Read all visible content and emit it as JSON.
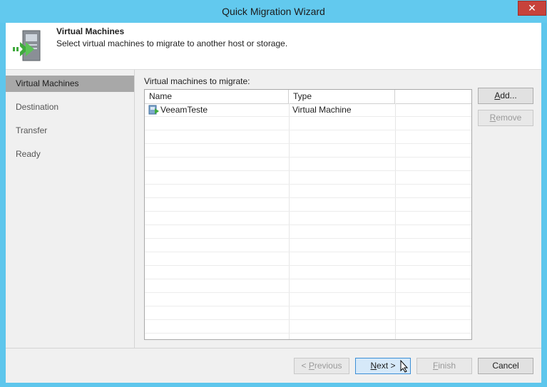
{
  "window": {
    "title": "Quick Migration Wizard",
    "close_glyph": "✕"
  },
  "header": {
    "title": "Virtual Machines",
    "subtitle": "Select virtual machines to migrate to another host or storage.",
    "icon": "vm-migrate-icon"
  },
  "steps": [
    {
      "label": "Virtual Machines",
      "active": true
    },
    {
      "label": "Destination",
      "active": false
    },
    {
      "label": "Transfer",
      "active": false
    },
    {
      "label": "Ready",
      "active": false
    }
  ],
  "main": {
    "list_label": "Virtual machines to migrate:",
    "columns": [
      "Name",
      "Type"
    ],
    "rows": [
      {
        "name": "VeeamTeste",
        "type": "Virtual Machine",
        "icon": "vm-icon"
      }
    ],
    "buttons": {
      "add_label_u": "A",
      "add_label_rest": "dd...",
      "remove_label_u": "R",
      "remove_label_rest": "emove"
    }
  },
  "footer": {
    "previous_pre": "< ",
    "previous_u": "P",
    "previous_rest": "revious",
    "next_u": "N",
    "next_rest": "ext >",
    "finish_u": "F",
    "finish_rest": "inish",
    "cancel_label": "Cancel"
  },
  "colors": {
    "titlebar": "#62c9ee",
    "selected_step": "#a8a8a8",
    "close": "#c7423b"
  }
}
